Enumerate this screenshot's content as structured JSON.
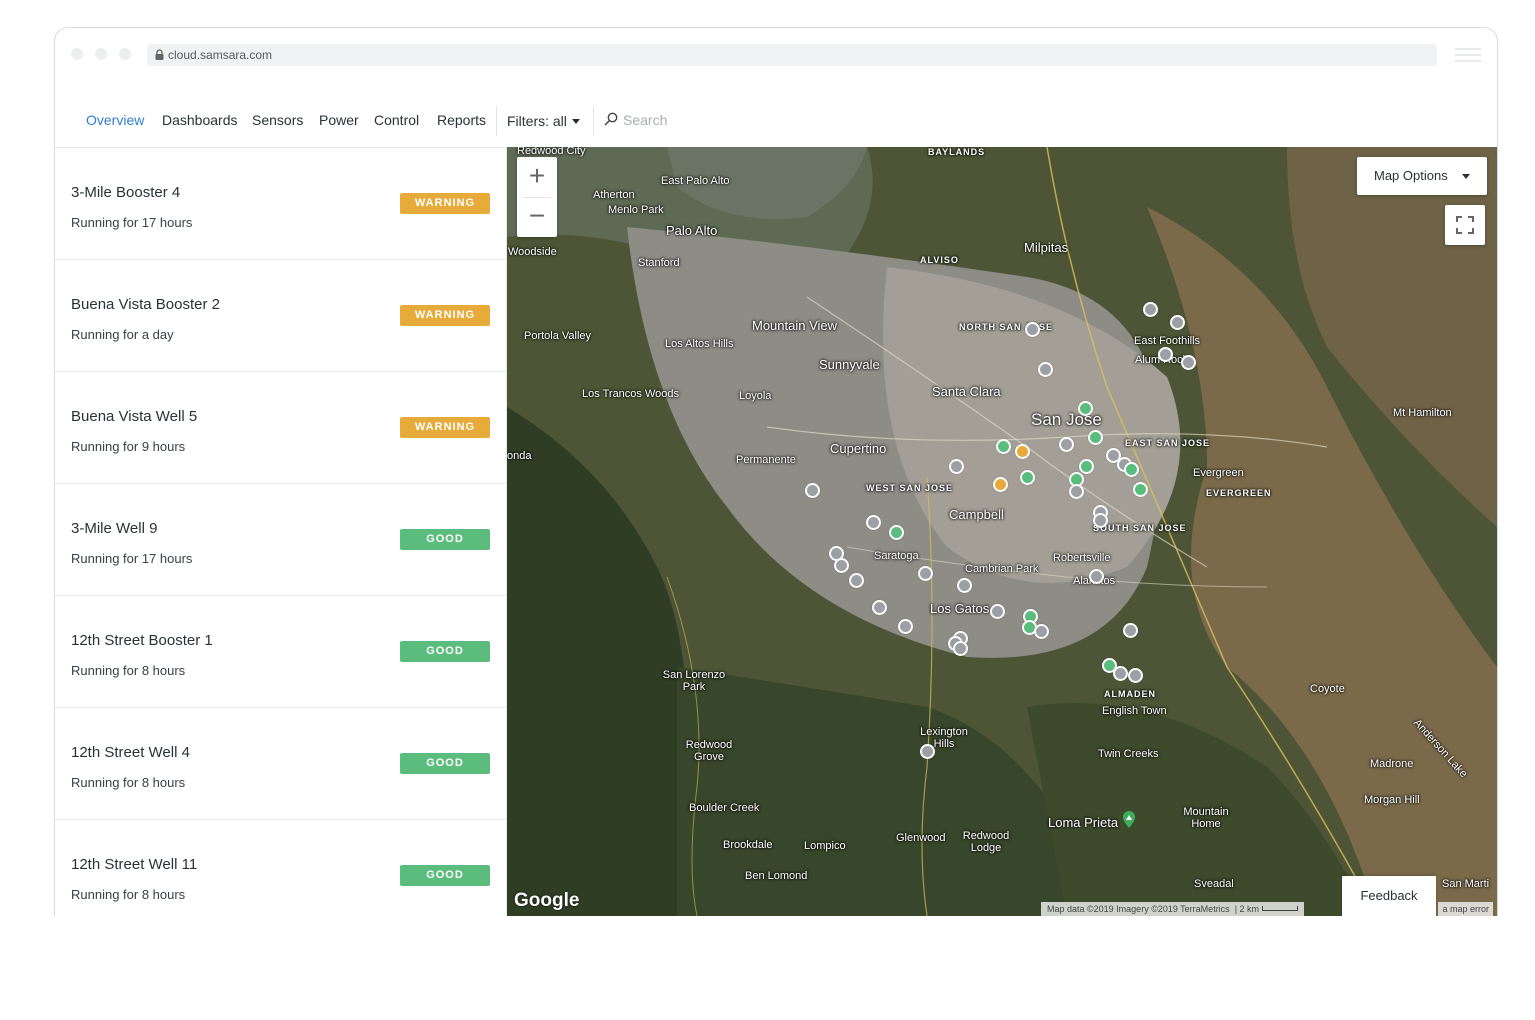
{
  "browser": {
    "url": "cloud.samsara.com"
  },
  "nav": {
    "tabs": [
      "Overview",
      "Dashboards",
      "Sensors",
      "Power",
      "Control",
      "Reports"
    ],
    "filters_label": "Filters: all",
    "search_placeholder": "Search"
  },
  "assets": [
    {
      "name": "3-Mile Booster 4",
      "status_text": "Running for 17 hours",
      "badge": "WARNING"
    },
    {
      "name": "Buena Vista Booster 2",
      "status_text": "Running for a day",
      "badge": "WARNING"
    },
    {
      "name": "Buena Vista Well 5",
      "status_text": "Running for 9 hours",
      "badge": "WARNING"
    },
    {
      "name": "3-Mile Well 9",
      "status_text": "Running for 17 hours",
      "badge": "GOOD"
    },
    {
      "name": "12th Street Booster 1",
      "status_text": "Running for 8 hours",
      "badge": "GOOD"
    },
    {
      "name": "12th Street Well 4",
      "status_text": "Running for 8 hours",
      "badge": "GOOD"
    },
    {
      "name": "12th Street Well 11",
      "status_text": "Running for 8 hours",
      "badge": "GOOD"
    }
  ],
  "colors": {
    "warning": "#e6ab3a",
    "good": "#5bbd7d",
    "active_tab": "#2f7fcf"
  },
  "map": {
    "zoom_in": "+",
    "zoom_out": "−",
    "options_label": "Map Options",
    "feedback_label": "Feedback",
    "google_logo": "Google",
    "attribution": "Map data ©2019 Imagery ©2019 TerraMetrics",
    "scale": "2 km",
    "report_error": "a map error",
    "places": [
      "Redwood City",
      "East Palo Alto",
      "Atherton",
      "Menlo Park",
      "Palo Alto",
      "Stanford",
      "Woodside",
      "Milpitas",
      "ALVISO",
      "BAYLANDS",
      "NORTH SAN JOSE",
      "East Foothills",
      "Alum Rock",
      "Mountain View",
      "Los Altos Hills",
      "Sunnyvale",
      "Santa Clara",
      "San Jose",
      "Portola Valley",
      "Los Trancos Woods",
      "Loyola",
      "Cupertino",
      "Permanente",
      "WEST SAN JOSE",
      "EAST SAN JOSE",
      "Evergreen",
      "EVERGREEN",
      "Campbell",
      "SOUTH SAN JOSE",
      "Saratoga",
      "Cambrian Park",
      "Robertsville",
      "Alamitos",
      "Los Gatos",
      "Mt Hamilton",
      "San Lorenzo Park",
      "ALMADEN",
      "English Town",
      "Coyote",
      "Lexington Hills",
      "Redwood Grove",
      "Twin Creeks",
      "Madrone",
      "Anderson Lake",
      "Morgan Hill",
      "Boulder Creek",
      "Loma Prieta",
      "Mountain Home",
      "Glenwood",
      "Redwood Lodge",
      "Brookdale",
      "Lompico",
      "Ben Lomond",
      "Sveadal",
      "San Marti",
      "onda"
    ]
  }
}
